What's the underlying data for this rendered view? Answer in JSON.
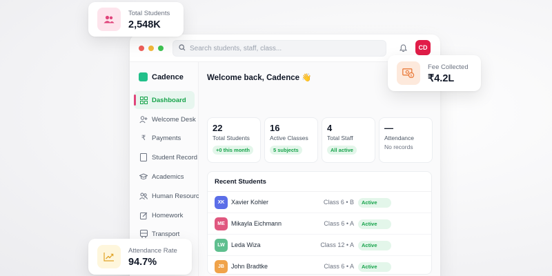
{
  "colors": {
    "brand": "#22c08a",
    "active_nav": "#16a34a",
    "avatar": "#e11d48",
    "badge_bg": "#e3f6ea"
  },
  "float_cards": {
    "total_students": {
      "label": "Total Students",
      "value": "2,548K",
      "icon": "users-icon"
    },
    "fee_collected": {
      "label": "Fee Collected",
      "value": "₹4.2L",
      "icon": "money-icon"
    },
    "attendance_rate": {
      "label": "Attendance Rate",
      "value": "94.7%",
      "icon": "trend-up-icon"
    }
  },
  "topbar": {
    "search_placeholder": "Search students, staff, class...",
    "avatar_initials": "CD"
  },
  "brand": {
    "name": "Cadence"
  },
  "sidebar": {
    "items": [
      {
        "label": "Dashboard",
        "icon": "grid-icon",
        "active": true
      },
      {
        "label": "Welcome Desk",
        "icon": "user-plus-icon"
      },
      {
        "label": "Payments",
        "icon": "rupee-icon"
      },
      {
        "label": "Student Record",
        "icon": "file-icon"
      },
      {
        "label": "Academics",
        "icon": "graduation-cap-icon"
      },
      {
        "label": "Human Resource",
        "icon": "people-icon"
      },
      {
        "label": "Homework",
        "icon": "edit-icon"
      },
      {
        "label": "Transport",
        "icon": "bus-icon"
      }
    ]
  },
  "main": {
    "welcome": "Welcome back, Cadence 👋",
    "stats": [
      {
        "value": "22",
        "label": "Total Students",
        "badge": "+0 this month"
      },
      {
        "value": "16",
        "label": "Active Classes",
        "badge": "5 subjects"
      },
      {
        "value": "4",
        "label": "Total Staff",
        "badge": "All active"
      },
      {
        "value": "—",
        "label": "Attendance",
        "sub": "No records"
      }
    ],
    "recent": {
      "title": "Recent Students",
      "rows": [
        {
          "initials": "XK",
          "name": "Xavier Kohler",
          "class": "Class 6 • B",
          "status": "Active",
          "color": "#5b6ee8"
        },
        {
          "initials": "ME",
          "name": "Mikayla Eichmann",
          "class": "Class 6 • A",
          "status": "Active",
          "color": "#e0577f"
        },
        {
          "initials": "LW",
          "name": "Leda Wiza",
          "class": "Class 12 • A",
          "status": "Active",
          "color": "#5fbf8f"
        },
        {
          "initials": "JB",
          "name": "John Bradtke",
          "class": "Class 6 • A",
          "status": "Active",
          "color": "#f0a34a"
        }
      ]
    }
  }
}
